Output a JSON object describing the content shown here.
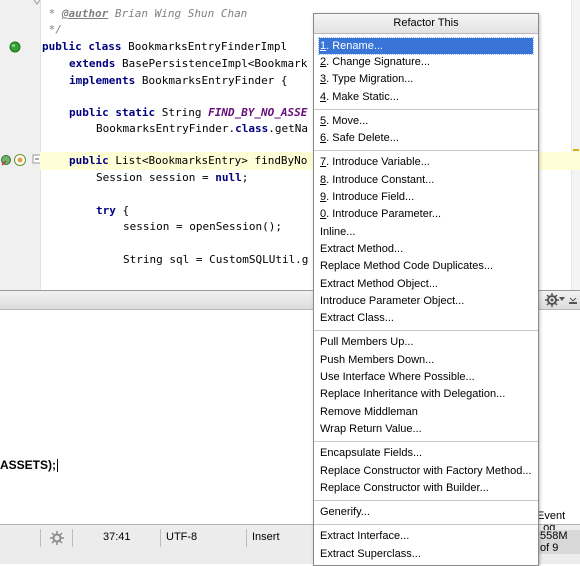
{
  "editor": {
    "line_comment_author_prefix": " * ",
    "line_comment_author_tag": "@author",
    "line_comment_author_name": " Brian Wing Shun Chan",
    "line_comment_end": " */",
    "kw_public": "public",
    "kw_class": "class",
    "class_name": " BookmarksEntryFinderImpl",
    "kw_extends": "extends",
    "extends_text": " BasePersistenceImpl<Bookmark",
    "kw_implements": "implements",
    "implements_text": " BookmarksEntryFinder {",
    "kw_public_static": "public static",
    "string_type": " String ",
    "const_name": "FIND_BY_NO_ASSE",
    "finder_call_a": "BookmarksEntryFinder.",
    "kw_class2": "class",
    "finder_call_b": ".getNa",
    "method_sig_type": " List<BookmarksEntry> findByNo",
    "session_decl_a": "Session session = ",
    "kw_null": "null",
    "semicolon": ";",
    "kw_try": "try",
    "try_brace": " {",
    "open_session": "session = openSession();",
    "sql_line": "String sql = CustomSQLUtil.g"
  },
  "console": {
    "text": "ASSETS);"
  },
  "statusbar": {
    "position": "37:41",
    "encoding": "UTF-8",
    "insert_mode": "Insert",
    "event_log": "Event Log",
    "memory": "558M of 9"
  },
  "menu": {
    "title": "Refactor This",
    "groups": [
      [
        {
          "key": "1",
          "label": ". Rename..."
        },
        {
          "key": "2",
          "label": ". Change Signature..."
        },
        {
          "key": "3",
          "label": ". Type Migration..."
        },
        {
          "key": "4",
          "label": ". Make Static..."
        }
      ],
      [
        {
          "key": "5",
          "label": ". Move..."
        },
        {
          "key": "6",
          "label": ". Safe Delete..."
        }
      ],
      [
        {
          "key": "7",
          "label": ". Introduce Variable..."
        },
        {
          "key": "8",
          "label": ". Introduce Constant..."
        },
        {
          "key": "9",
          "label": ". Introduce Field..."
        },
        {
          "key": "0",
          "label": ". Introduce Parameter..."
        },
        {
          "key": "",
          "label": "Inline..."
        },
        {
          "key": "",
          "label": "Extract Method..."
        },
        {
          "key": "",
          "label": "Replace Method Code Duplicates..."
        },
        {
          "key": "",
          "label": "Extract Method Object..."
        },
        {
          "key": "",
          "label": "Introduce Parameter Object..."
        },
        {
          "key": "",
          "label": "Extract Class..."
        }
      ],
      [
        {
          "key": "",
          "label": "Pull Members Up..."
        },
        {
          "key": "",
          "label": "Push Members Down..."
        },
        {
          "key": "",
          "label": "Use Interface Where Possible..."
        },
        {
          "key": "",
          "label": "Replace Inheritance with Delegation..."
        },
        {
          "key": "",
          "label": "Remove Middleman"
        },
        {
          "key": "",
          "label": "Wrap Return Value..."
        }
      ],
      [
        {
          "key": "",
          "label": "Encapsulate Fields..."
        },
        {
          "key": "",
          "label": "Replace Constructor with Factory Method..."
        },
        {
          "key": "",
          "label": "Replace Constructor with Builder..."
        }
      ],
      [
        {
          "key": "",
          "label": "Generify..."
        }
      ],
      [
        {
          "key": "",
          "label": "Extract Interface..."
        },
        {
          "key": "",
          "label": "Extract Superclass..."
        }
      ]
    ]
  },
  "colors": {
    "selection": "#3875d7",
    "keyword": "#000080",
    "constant": "#660e7a",
    "comment": "#808080",
    "current_line": "#ffffd7"
  }
}
